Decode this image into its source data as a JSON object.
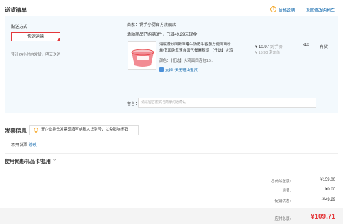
{
  "header": {
    "title": "送货清单",
    "price_note_link": "价格说明",
    "back_to_cart_link": "返回修改购物车"
  },
  "delivery": {
    "method_label": "配送方式",
    "method_option": "快速运输",
    "eta": "预计24小时内发货，明天送达"
  },
  "shop": {
    "merchant_line": "商家：锅手小厨官方旗舰店",
    "promo_line": "活动商品已购满8件，已减49.29元现金"
  },
  "product": {
    "title_line1": "海底捞炒面新面罐牛汤肥牛番茄方便面面粉",
    "title_line2": "丝/宽面免煮速食面代餐麻辣烫 【任选】火鸡",
    "color_line": "颜色：【任选】火鸡面四连包15...",
    "support": "支持7天无理由退货",
    "price": "¥ 10.97",
    "price_tag": "到手价",
    "original_price": "¥ 15.90 京东价",
    "quantity": "x10",
    "stock": "有货"
  },
  "note": {
    "label": "留言：",
    "placeholder": "请以留言形式与商家沟通确认"
  },
  "invoice": {
    "title": "发票信息",
    "tip": "开企业抬头发票须填写纳税人识别号，以免影响报销",
    "status": "不开发票",
    "edit_link": "修改"
  },
  "coupon": {
    "title": "使用优惠/礼品卡/抵用"
  },
  "summary": {
    "items_label": "总商品金额:",
    "items_value": "¥159.00",
    "shipping_label": "运费:",
    "shipping_value": "¥0.00",
    "discount_label": "促销优惠:",
    "discount_value": "-¥49.29",
    "total_label": "应付总额:",
    "total_value": "¥109.71"
  },
  "colors": {
    "accent_red": "#e4393c",
    "link_blue": "#005ea7",
    "panel_bg": "#f3f9fd",
    "warn_orange": "#f5a623"
  }
}
